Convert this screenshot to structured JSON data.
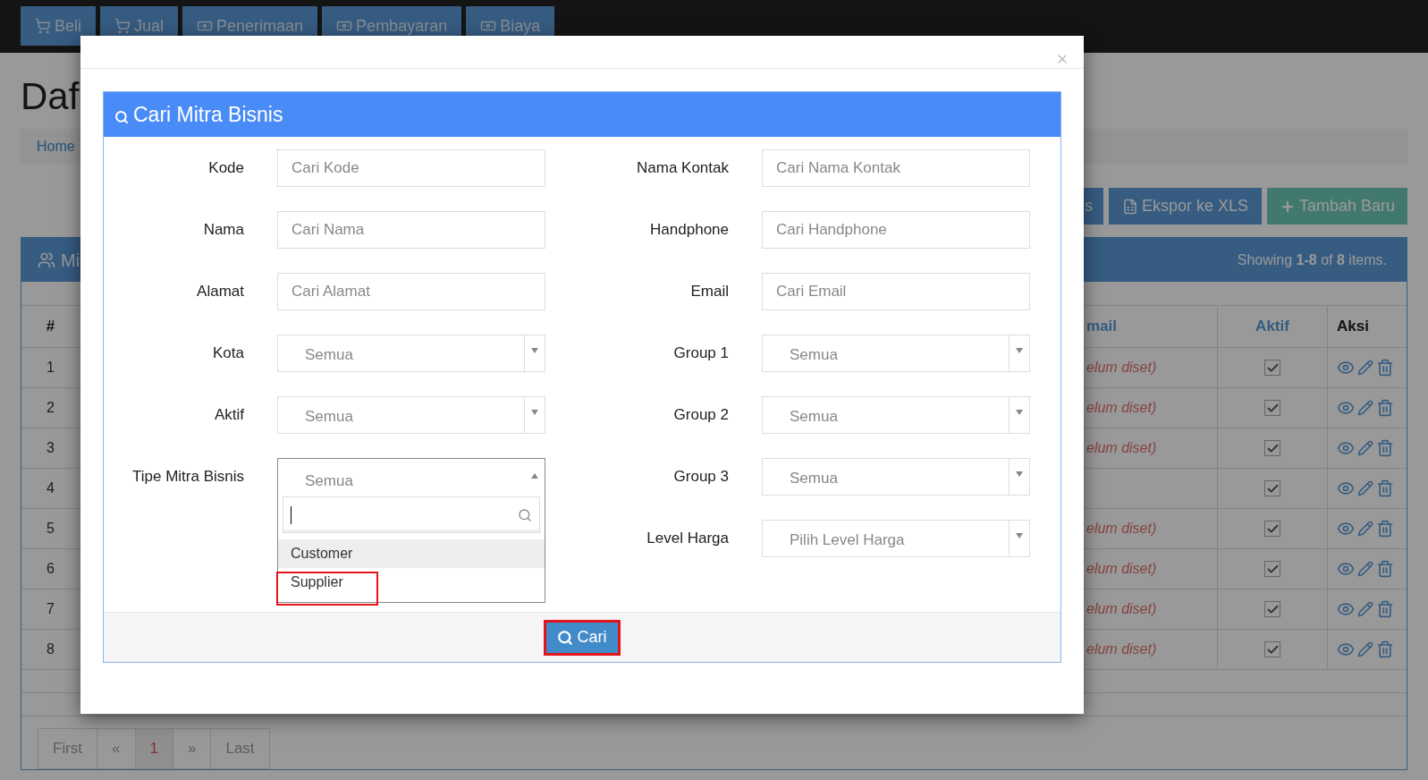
{
  "nav_tabs": [
    {
      "label": "Beli",
      "kind": "cart"
    },
    {
      "label": "Jual",
      "kind": "cart"
    },
    {
      "label": "Penerimaan",
      "kind": "money"
    },
    {
      "label": "Pembayaran",
      "kind": "money"
    },
    {
      "label": "Biaya",
      "kind": "money"
    }
  ],
  "page": {
    "title": "Daf",
    "breadcrumb": "Home",
    "actions": [
      {
        "label": "s",
        "kind": "plain"
      },
      {
        "label": "Ekspor ke XLS",
        "kind": "export"
      },
      {
        "label": "Tambah Baru",
        "kind": "add"
      }
    ],
    "panel": {
      "title": "Mi",
      "summary": "Showing **1-8** of **8** items."
    },
    "table": {
      "columns": [
        {
          "label": "#",
          "kind": "plain"
        },
        {
          "label": "mail",
          "kind": "link"
        },
        {
          "label": "Aktif",
          "kind": "link"
        },
        {
          "label": "Aksi",
          "kind": "plain"
        }
      ],
      "rows": [
        {
          "number": "1",
          "email": "elum diset)",
          "active": true
        },
        {
          "number": "2",
          "email": "elum diset)",
          "active": true
        },
        {
          "number": "3",
          "email": "elum diset)",
          "active": true
        },
        {
          "number": "4",
          "active": true
        },
        {
          "number": "5",
          "email": "elum diset)",
          "active": true
        },
        {
          "number": "6",
          "email": "elum diset)",
          "active": true
        },
        {
          "number": "7",
          "email": "elum diset)",
          "active": true
        },
        {
          "number": "8",
          "email": "elum diset)",
          "active": true
        }
      ]
    },
    "pagination": [
      {
        "label": "First",
        "selected": false
      },
      {
        "label": "«",
        "selected": false
      },
      {
        "label": "1",
        "selected": true
      },
      {
        "label": "»",
        "selected": false
      },
      {
        "label": "Last",
        "selected": false
      }
    ]
  },
  "modal": {
    "panel_title": "Cari Mitra Bisnis",
    "left_fields": [
      {
        "label": "Kode",
        "kind": "text",
        "placeholder": "Cari Kode"
      },
      {
        "label": "Nama",
        "kind": "text",
        "placeholder": "Cari Nama"
      },
      {
        "label": "Alamat",
        "kind": "text",
        "placeholder": "Cari Alamat"
      },
      {
        "label": "Kota",
        "kind": "select",
        "value": "Semua"
      },
      {
        "label": "Aktif",
        "kind": "select",
        "value": "Semua"
      },
      {
        "label": "Tipe Mitra Bisnis",
        "kind": "open_select",
        "value": "Semua",
        "options": [
          {
            "label": "Customer",
            "highlighted": true,
            "annotated": false
          },
          {
            "label": "Supplier",
            "highlighted": false,
            "annotated": true
          }
        ]
      }
    ],
    "right_fields": [
      {
        "label": "Nama Kontak",
        "kind": "text",
        "placeholder": "Cari Nama Kontak"
      },
      {
        "label": "Handphone",
        "kind": "text",
        "placeholder": "Cari Handphone"
      },
      {
        "label": "Email",
        "kind": "text",
        "placeholder": "Cari Email"
      },
      {
        "label": "Group 1",
        "kind": "select",
        "value": "Semua"
      },
      {
        "label": "Group 2",
        "kind": "select",
        "value": "Semua"
      },
      {
        "label": "Group 3",
        "kind": "select",
        "value": "Semua"
      },
      {
        "label": "Level Harga",
        "kind": "select",
        "value": "Pilih Level Harga"
      }
    ],
    "search_button": {
      "label": "Cari",
      "annotated": true
    }
  }
}
